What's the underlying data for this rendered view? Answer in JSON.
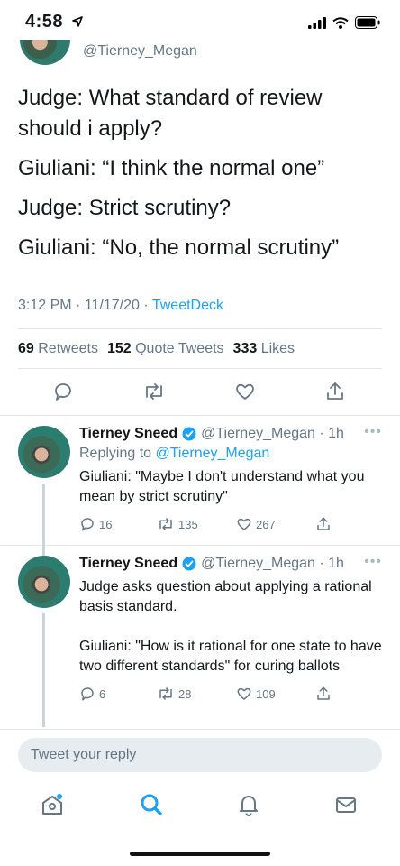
{
  "status_bar": {
    "time": "4:58"
  },
  "header": {
    "handle": "@Tierney_Megan"
  },
  "main_tweet": {
    "lines": [
      "Judge: What standard of review should i apply?",
      "Giuliani: “I think the normal one”",
      "Judge: Strict scrutiny?",
      "Giuliani: “No, the normal scrutiny”"
    ],
    "time": "3:12 PM",
    "date": "11/17/20",
    "source": "TweetDeck",
    "retweets_count": "69",
    "retweets_label": "Retweets",
    "quotes_count": "152",
    "quotes_label": "Quote Tweets",
    "likes_count": "333",
    "likes_label": "Likes"
  },
  "replies": [
    {
      "name": "Tierney Sneed",
      "handle": "@Tierney_Megan",
      "age": "1h",
      "replying_label": "Replying to",
      "replying_to": "@Tierney_Megan",
      "text": "Giuliani: \"Maybe I don't understand what you mean by strict scrutiny\"",
      "replies": "16",
      "retweets": "135",
      "likes": "267"
    },
    {
      "name": "Tierney Sneed",
      "handle": "@Tierney_Megan",
      "age": "1h",
      "text": "Judge asks question about applying a rational basis standard.",
      "text2": "Giuliani: \"How is it rational for one state to have two different standards\" for curing ballots",
      "replies": "6",
      "retweets": "28",
      "likes": "109"
    }
  ],
  "compose": {
    "placeholder": "Tweet your reply"
  },
  "colors": {
    "accent": "#1da1f2",
    "muted": "#657786",
    "text": "#14171a"
  }
}
